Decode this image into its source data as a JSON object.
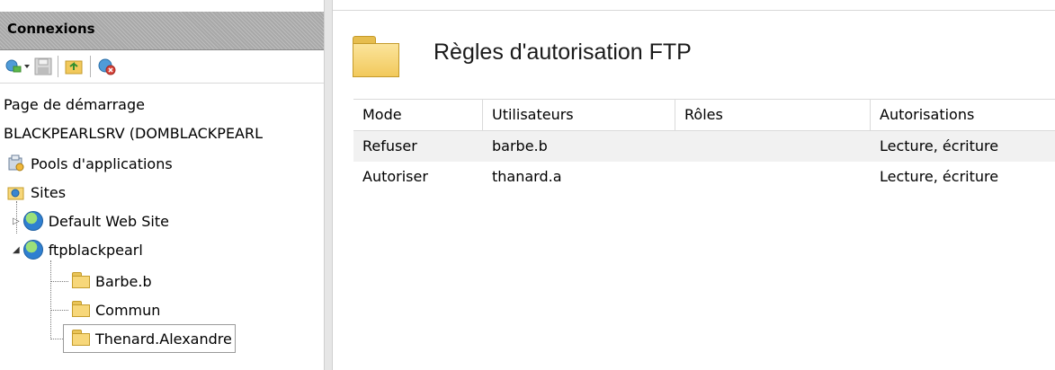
{
  "connections": {
    "title": "Connexions",
    "tree": {
      "start_page": "Page de démarrage",
      "server": "BLACKPEARLSRV (DOMBLACKPEARL",
      "app_pools": "Pools d'applications",
      "sites": "Sites",
      "default_site": "Default Web Site",
      "ftp_site": "ftpblackpearl",
      "folders": [
        "Barbe.b",
        "Commun",
        "Thenard.Alexandre"
      ]
    }
  },
  "main": {
    "title": "Règles d'autorisation FTP",
    "columns": [
      "Mode",
      "Utilisateurs",
      "Rôles",
      "Autorisations"
    ],
    "rows": [
      {
        "mode": "Refuser",
        "users": "barbe.b",
        "roles": "",
        "permissions": "Lecture, écriture"
      },
      {
        "mode": "Autoriser",
        "users": "thanard.a",
        "roles": "",
        "permissions": "Lecture, écriture"
      }
    ]
  },
  "icons": {
    "connect": "connect-icon",
    "save": "save-icon",
    "up": "up-folder-icon",
    "disconnect": "disconnect-icon"
  }
}
